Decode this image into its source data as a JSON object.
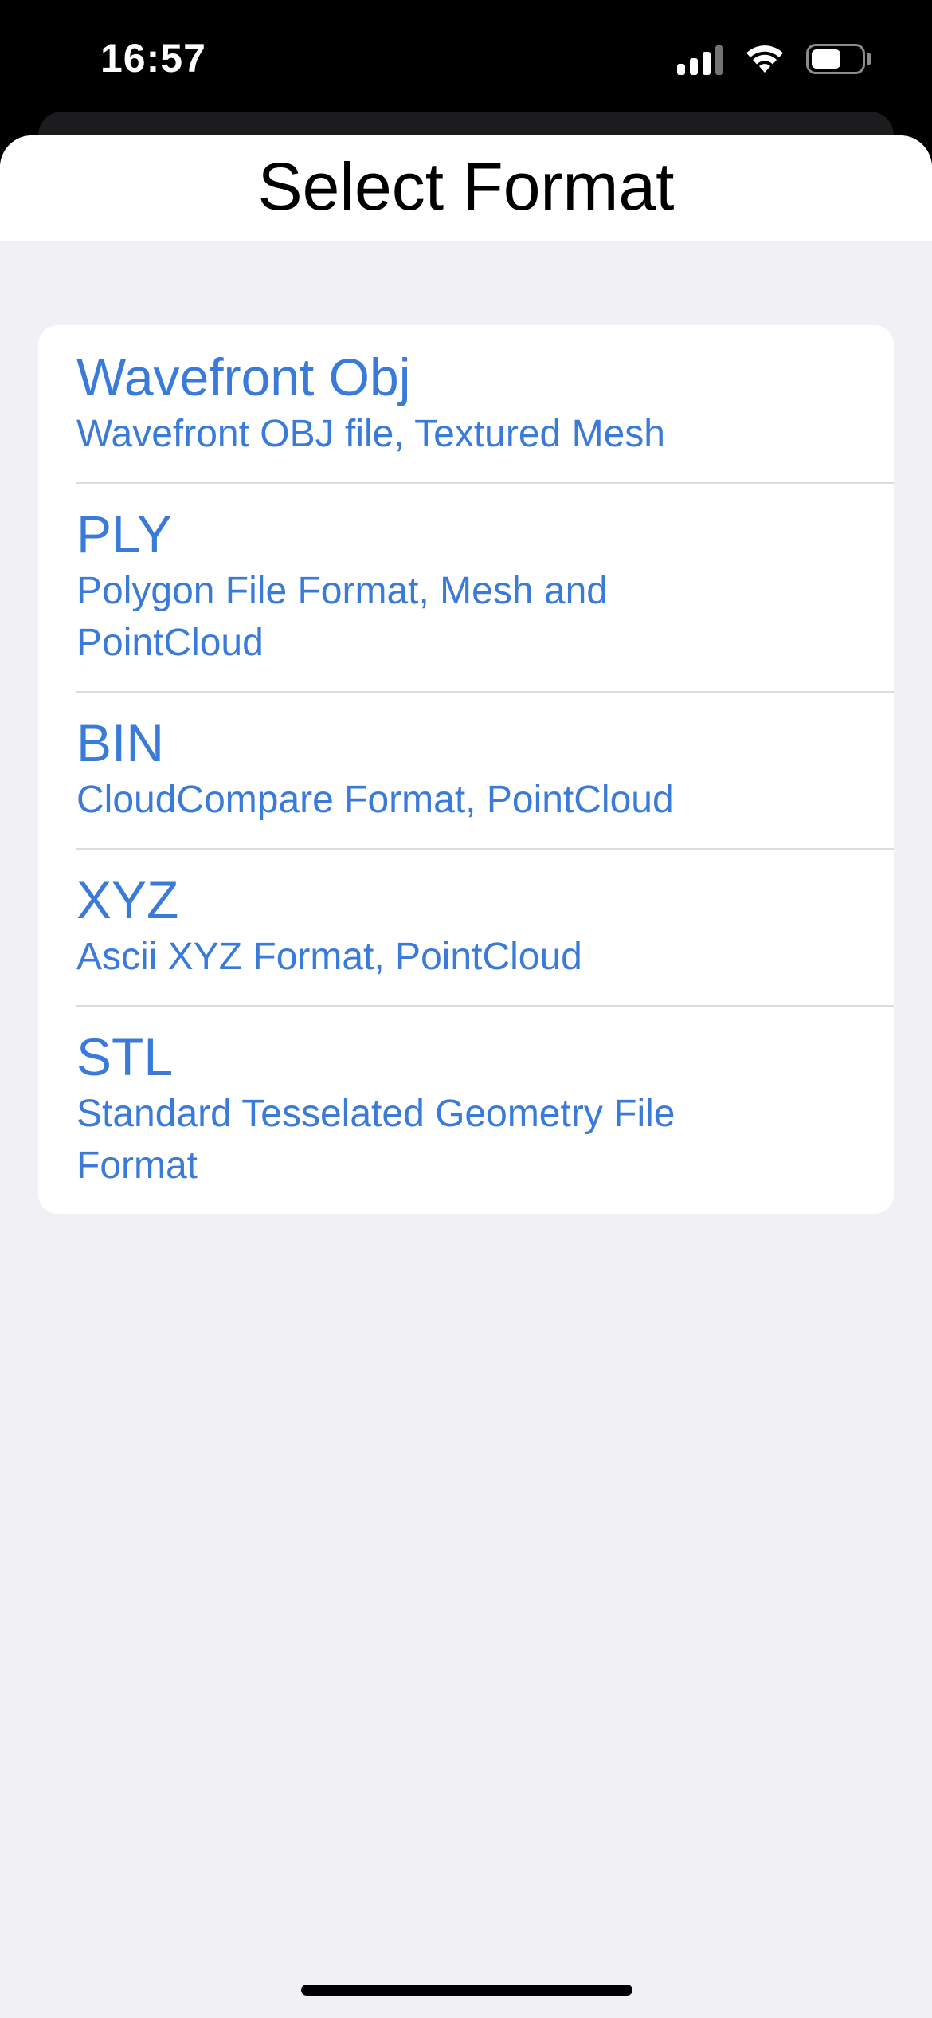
{
  "status_bar": {
    "time": "16:57",
    "icons": [
      "cellular-signal-icon",
      "wifi-icon",
      "battery-icon"
    ],
    "battery_level": 0.6
  },
  "sheet": {
    "title": "Select Format"
  },
  "formats": [
    {
      "name": "Wavefront Obj",
      "description": "Wavefront OBJ file, Textured Mesh"
    },
    {
      "name": "PLY",
      "description": "Polygon File Format, Mesh and PointCloud"
    },
    {
      "name": "BIN",
      "description": "CloudCompare Format, PointCloud"
    },
    {
      "name": "XYZ",
      "description": "Ascii XYZ Format, PointCloud"
    },
    {
      "name": "STL",
      "description": "Standard Tesselated Geometry File Format"
    }
  ],
  "colors": {
    "accent": "#3a7ad9",
    "sheet_background": "#f0f0f5",
    "card_background": "#ffffff"
  }
}
